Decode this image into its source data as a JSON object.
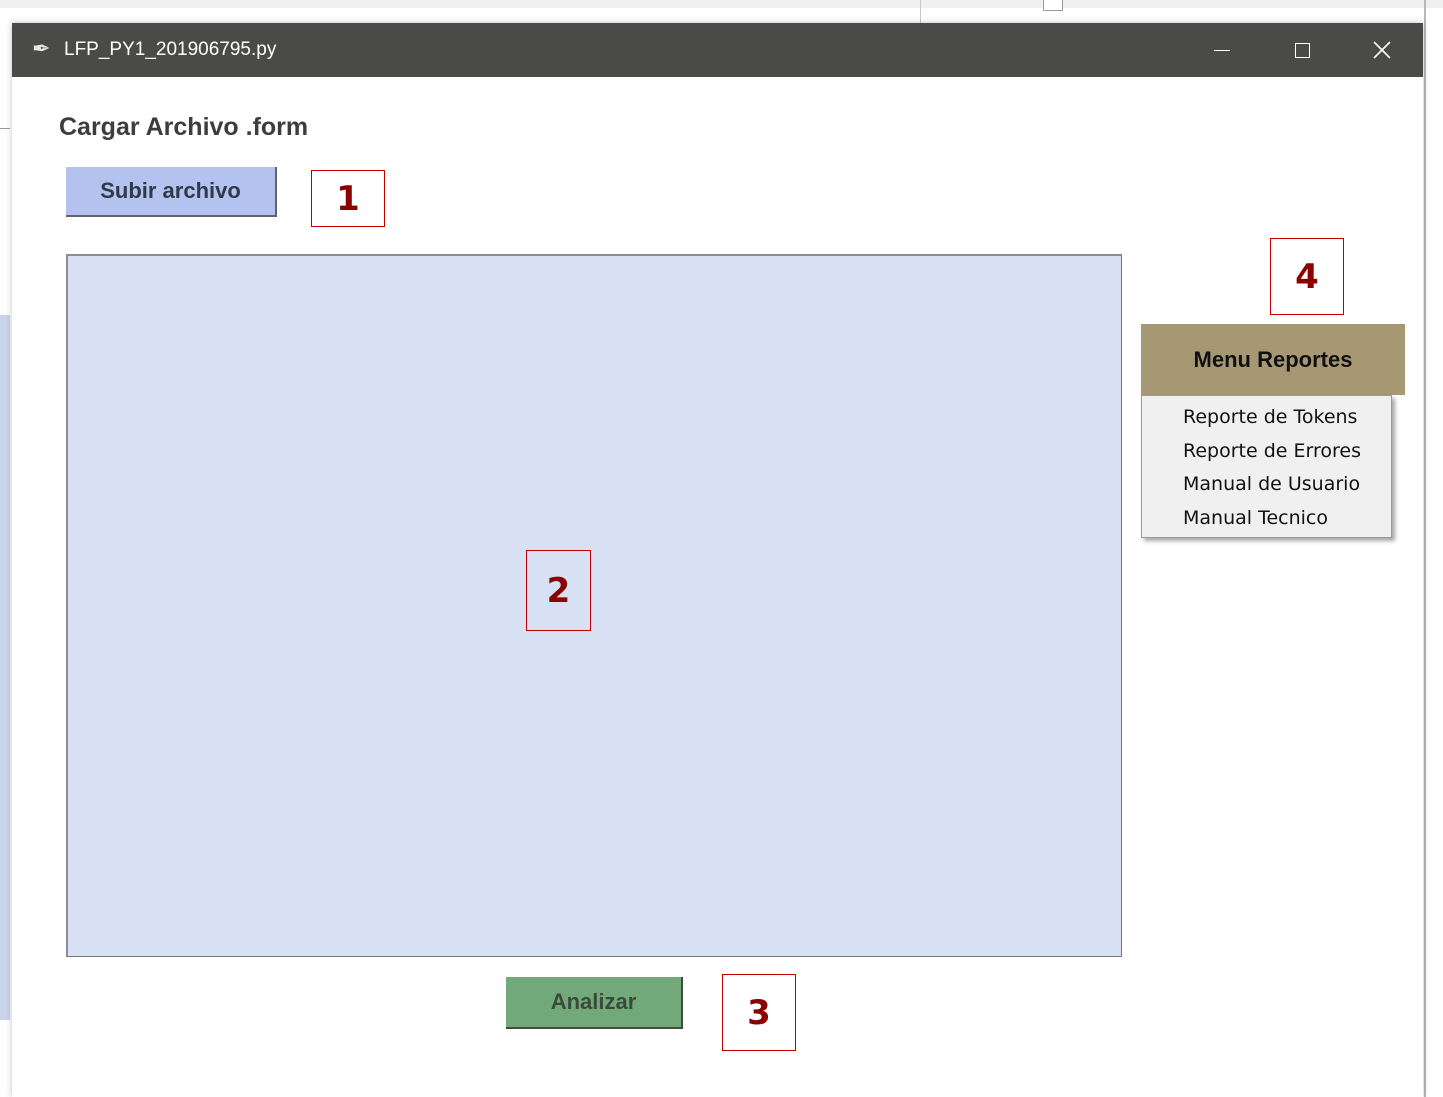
{
  "window": {
    "title": "LFP_PY1_201906795.py",
    "icon": "feather-icon"
  },
  "main": {
    "heading": "Cargar Archivo .form",
    "upload_button_label": "Subir archivo",
    "editor_value": "",
    "analyze_button_label": "Analizar"
  },
  "reports_menu": {
    "button_label": "Menu Reportes",
    "items": [
      {
        "label": "Reporte de Tokens"
      },
      {
        "label": "Reporte de Errores"
      },
      {
        "label": "Manual de Usuario"
      },
      {
        "label": "Manual Tecnico"
      }
    ]
  },
  "annotations": {
    "marker_1": "1",
    "marker_2": "2",
    "marker_3": "3",
    "marker_4": "4"
  },
  "colors": {
    "titlebar": "#4a4a48",
    "upload_button": "#b4c2f0",
    "editor_background": "#d8e0f3",
    "analyze_button": "#72a97a",
    "menu_button": "#a69873",
    "annotation": "#c00000"
  }
}
